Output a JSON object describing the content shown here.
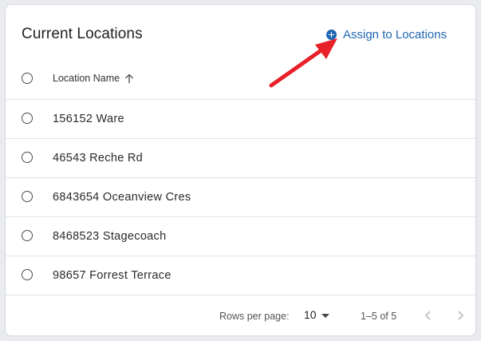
{
  "card": {
    "title": "Current Locations",
    "assign_label": "Assign to Locations"
  },
  "table": {
    "column_header": "Location Name",
    "rows": [
      {
        "name": "156152 Ware"
      },
      {
        "name": "46543 Reche Rd"
      },
      {
        "name": "6843654 Oceanview Cres"
      },
      {
        "name": "8468523 Stagecoach"
      },
      {
        "name": "98657 Forrest Terrace"
      }
    ]
  },
  "pagination": {
    "rows_per_page_label": "Rows per page:",
    "rows_per_page_value": "10",
    "range": "1–5 of 5"
  },
  "colors": {
    "accent": "#1f66b3",
    "annotation_arrow": "#e8202a"
  },
  "icons": [
    "plus-circle-icon",
    "arrow-up-icon",
    "caret-down-icon",
    "chevron-left-icon",
    "chevron-right-icon",
    "annotation-arrow"
  ]
}
